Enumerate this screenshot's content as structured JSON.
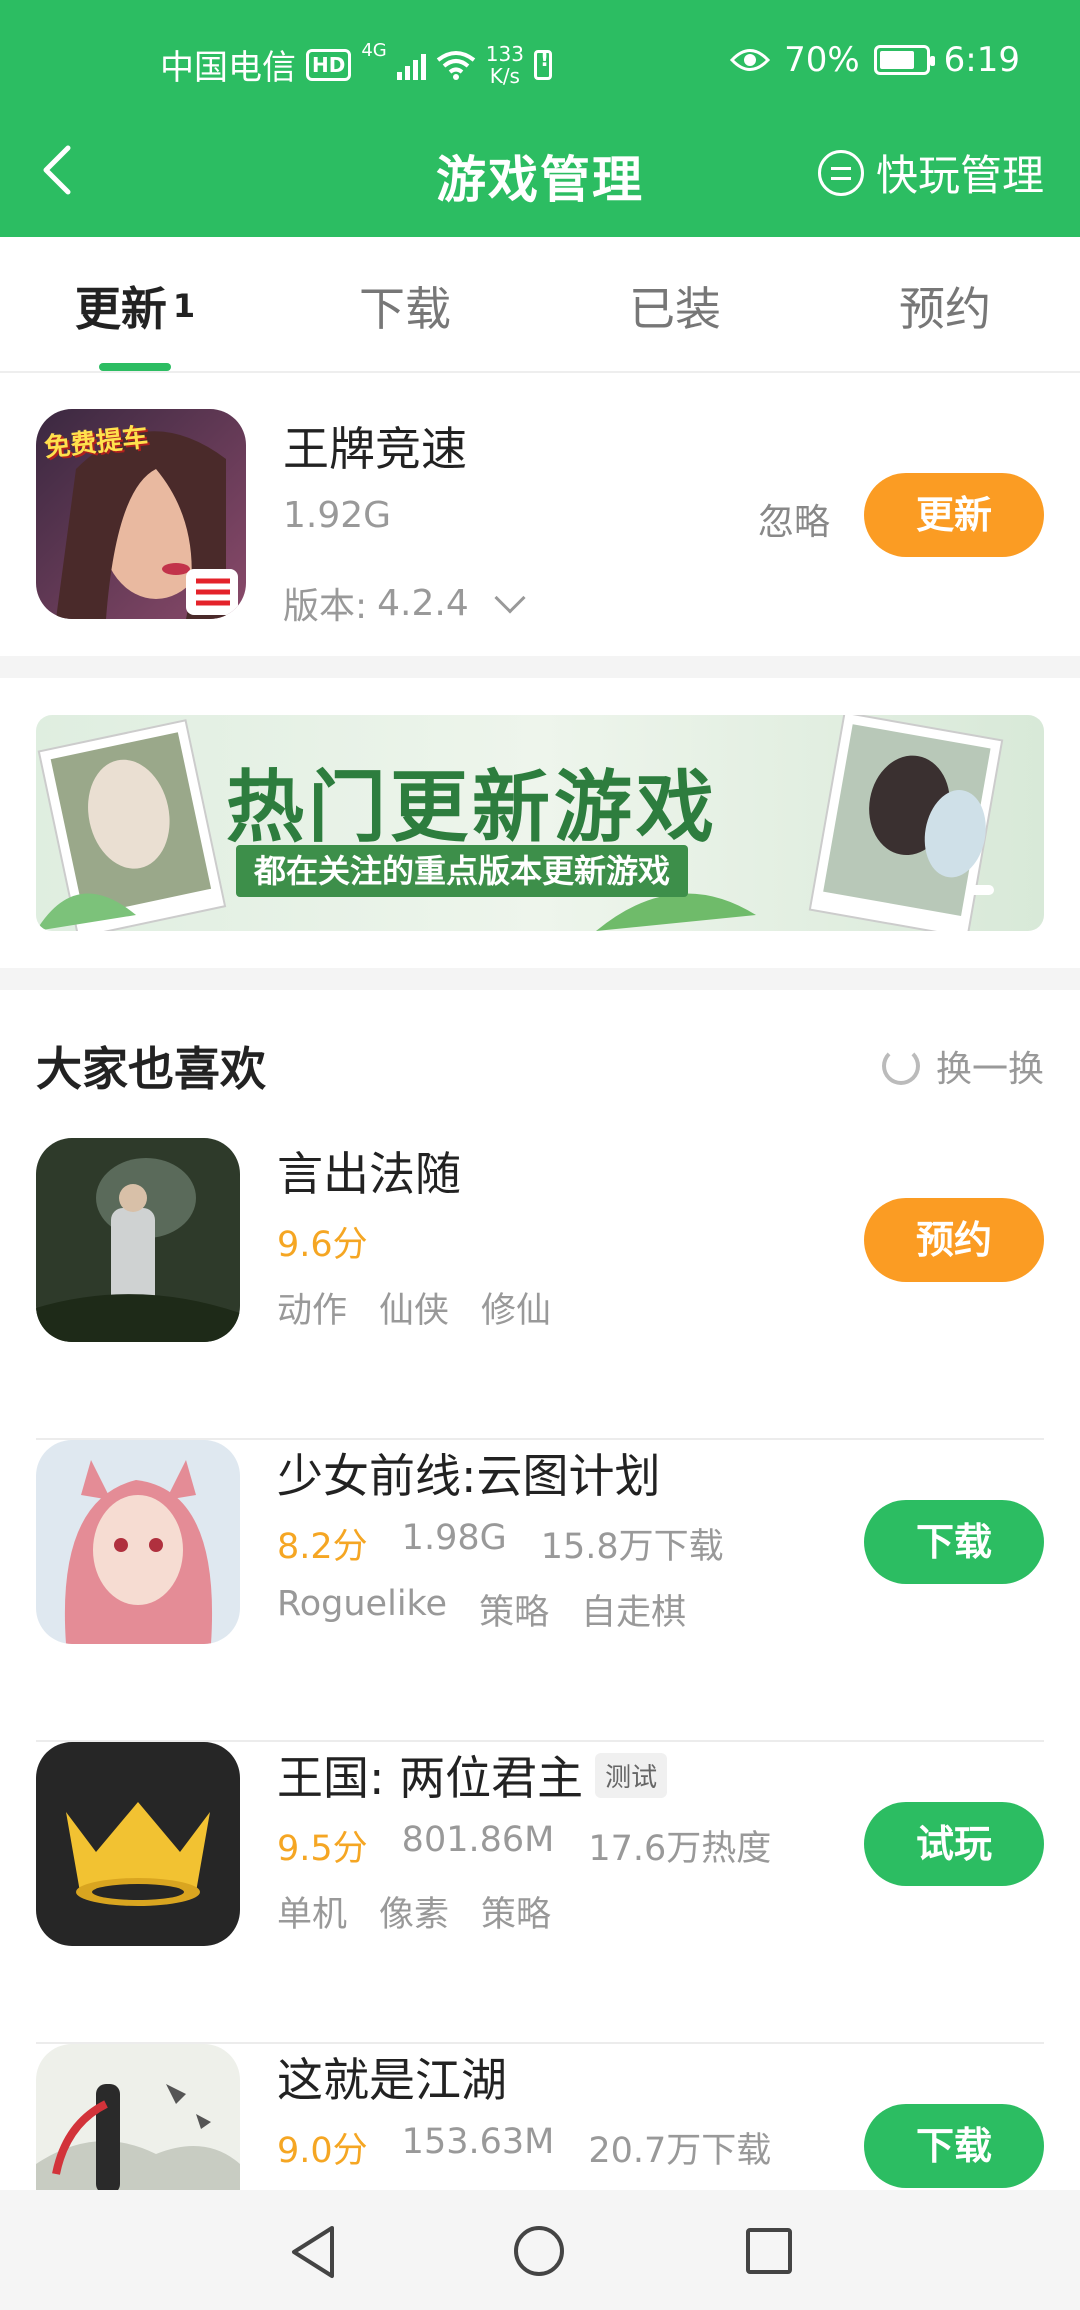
{
  "status_bar": {
    "carrier": "中国电信",
    "hd": "HD",
    "network": "4G",
    "speed_value": "133",
    "speed_unit": "K/s",
    "battery": "70%",
    "time": "6:19"
  },
  "header": {
    "title": "游戏管理",
    "quick_manage": "快玩管理"
  },
  "tabs": [
    {
      "label": "更新",
      "count": "1",
      "active": true
    },
    {
      "label": "下载"
    },
    {
      "label": "已装"
    },
    {
      "label": "预约"
    }
  ],
  "update_item": {
    "name": "王牌竞速",
    "size": "1.92G",
    "version_label": "版本:",
    "version": "4.2.4",
    "ignore": "忽略",
    "button": "更新",
    "icon_badge": "免费提车"
  },
  "banner": {
    "title": "热门更新游戏",
    "subtitle": "都在关注的重点版本更新游戏"
  },
  "recommend": {
    "title": "大家也喜欢",
    "refresh": "换一换",
    "games": [
      {
        "name": "言出法随",
        "score": "9.6分",
        "meta": [],
        "tags": [
          "动作",
          "仙侠",
          "修仙"
        ],
        "button": "预约",
        "button_color": "#fb9c23"
      },
      {
        "name": "少女前线:云图计划",
        "score": "8.2分",
        "meta": [
          "1.98G",
          "15.8万下载"
        ],
        "tags": [
          "Roguelike",
          "策略",
          "自走棋"
        ],
        "button": "下载",
        "button_color": "#2cbd62"
      },
      {
        "name": "王国: 两位君主",
        "badge": "测试",
        "score": "9.5分",
        "meta": [
          "801.86M",
          "17.6万热度"
        ],
        "tags": [
          "单机",
          "像素",
          "策略"
        ],
        "button": "试玩",
        "button_color": "#2cbd62"
      },
      {
        "name": "这就是江湖",
        "score": "9.0分",
        "meta": [
          "153.63M",
          "20.7万下载"
        ],
        "tags": [],
        "button": "下载",
        "button_color": "#2cbd62"
      }
    ]
  },
  "colors": {
    "brand_green": "#2cbd62",
    "accent_orange": "#fb9c23",
    "score_yellow": "#f5a623"
  }
}
